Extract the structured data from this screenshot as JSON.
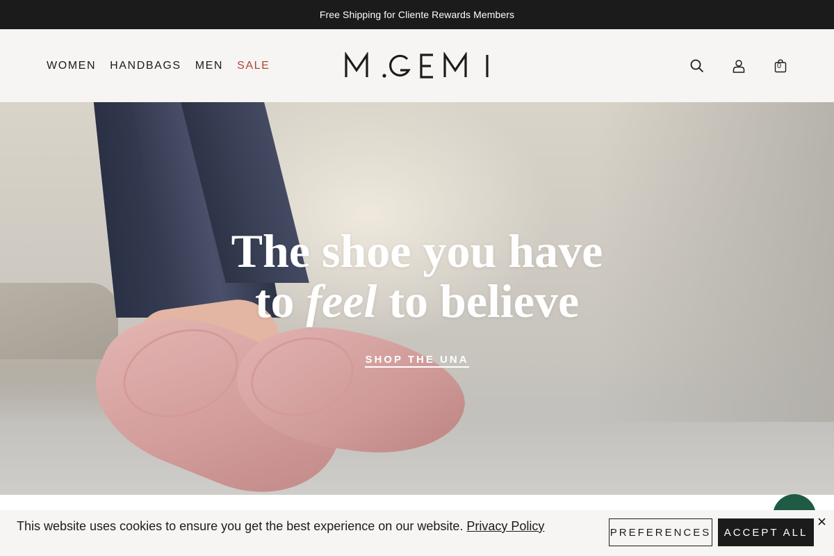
{
  "promo": {
    "text": "Free Shipping for Cliente Rewards Members"
  },
  "header": {
    "nav": [
      {
        "label": "Women"
      },
      {
        "label": "Handbags"
      },
      {
        "label": "Men"
      },
      {
        "label": "Sale"
      }
    ],
    "logo_text": "M.GEMI",
    "icons": {
      "search": "search-icon",
      "account": "user-icon",
      "cart": "bag-icon"
    },
    "cart_count": "0"
  },
  "hero": {
    "headline_line1": "The shoe you have",
    "headline_line2_pre": "to ",
    "headline_line2_em": "feel",
    "headline_line2_post": " to believe",
    "cta": "SHOP THE UNA"
  },
  "cookie": {
    "text": "This website uses cookies to ensure you get the best experience on our website.",
    "link": "Privacy Policy",
    "preferences": "PREFERENCES",
    "accept": "ACCEPT ALL"
  },
  "colors": {
    "promo_bg": "#1b1b1b",
    "header_bg": "#f6f5f3",
    "sale": "#b0442f",
    "chat": "#1f5a45"
  }
}
